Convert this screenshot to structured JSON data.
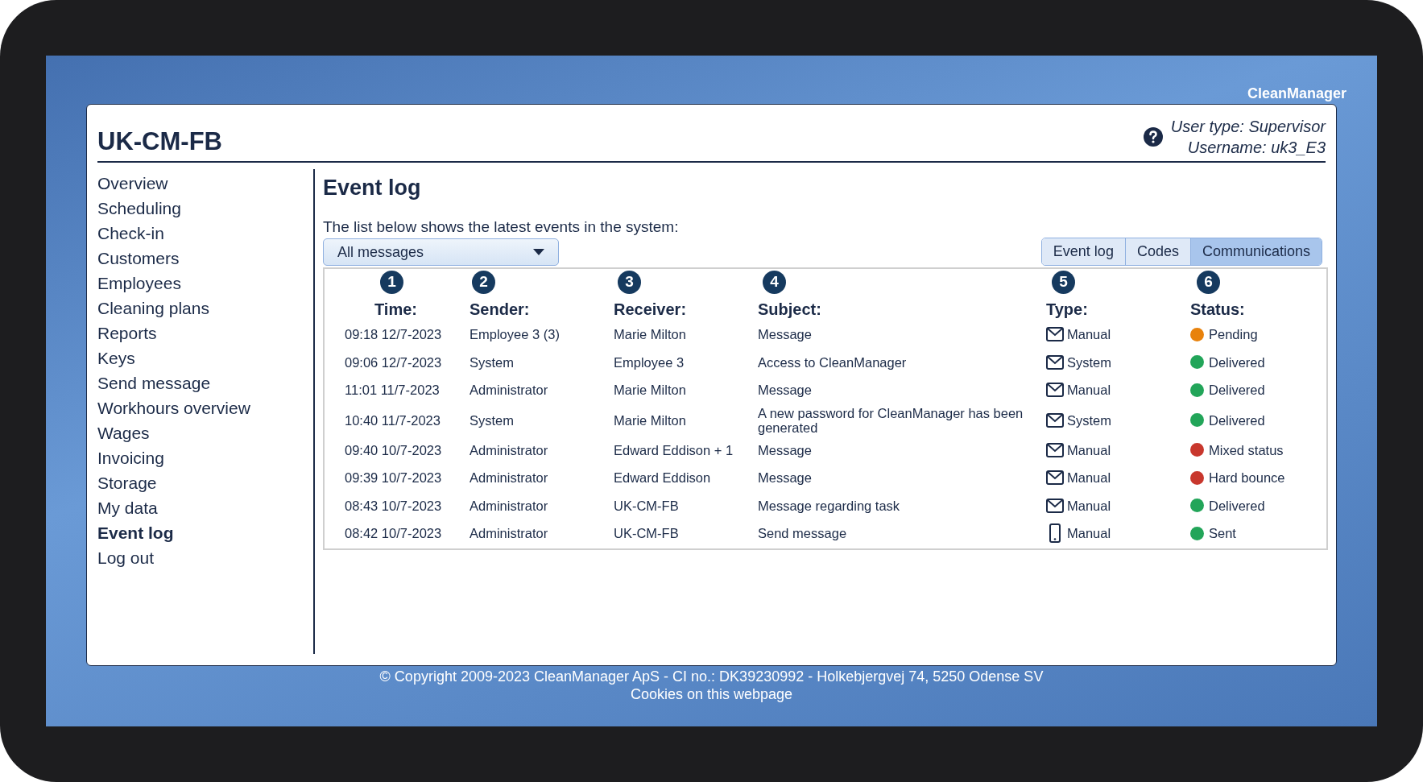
{
  "brand": "CleanManager",
  "header": {
    "title": "UK-CM-FB",
    "user_type": "User type: Supervisor",
    "username": "Username: uk3_E3"
  },
  "sidebar": {
    "items": [
      {
        "label": "Overview",
        "selected": false
      },
      {
        "label": "Scheduling",
        "selected": false
      },
      {
        "label": "Check-in",
        "selected": false
      },
      {
        "label": "Customers",
        "selected": false
      },
      {
        "label": "Employees",
        "selected": false
      },
      {
        "label": "Cleaning plans",
        "selected": false
      },
      {
        "label": "Reports",
        "selected": false
      },
      {
        "label": "Keys",
        "selected": false
      },
      {
        "label": "Send message",
        "selected": false
      },
      {
        "label": "Workhours overview",
        "selected": false
      },
      {
        "label": "Wages",
        "selected": false
      },
      {
        "label": "Invoicing",
        "selected": false
      },
      {
        "label": "Storage",
        "selected": false
      },
      {
        "label": "My data",
        "selected": false
      },
      {
        "label": "Event log",
        "selected": true
      },
      {
        "label": "Log out",
        "selected": false
      }
    ]
  },
  "main": {
    "heading": "Event log",
    "description": "The list below shows the latest events in the system:",
    "filter": {
      "value": "All messages"
    },
    "tabs": [
      {
        "label": "Event log",
        "selected": false
      },
      {
        "label": "Codes",
        "selected": false
      },
      {
        "label": "Communications",
        "selected": true
      }
    ],
    "callouts": [
      "1",
      "2",
      "3",
      "4",
      "5",
      "6"
    ],
    "table": {
      "columns": [
        "Time:",
        "Sender:",
        "Receiver:",
        "Subject:",
        "Type:",
        "Status:"
      ],
      "rows": [
        {
          "time": "09:18 12/7-2023",
          "sender": "Employee 3 (3)",
          "receiver": "Marie Milton",
          "subject": "Message",
          "kind": "email",
          "type": "Manual",
          "status": "Pending",
          "color": "#e8820c"
        },
        {
          "time": "09:06 12/7-2023",
          "sender": "System",
          "receiver": "Employee 3",
          "subject": "Access to CleanManager",
          "kind": "email",
          "type": "System",
          "status": "Delivered",
          "color": "#22a559"
        },
        {
          "time": "11:01 11/7-2023",
          "sender": "Administrator",
          "receiver": "Marie Milton",
          "subject": "Message",
          "kind": "email",
          "type": "Manual",
          "status": "Delivered",
          "color": "#22a559"
        },
        {
          "time": "10:40 11/7-2023",
          "sender": "System",
          "receiver": "Marie Milton",
          "subject": "A new password for CleanManager has been generated",
          "kind": "email",
          "type": "System",
          "status": "Delivered",
          "color": "#22a559"
        },
        {
          "time": "09:40 10/7-2023",
          "sender": "Administrator",
          "receiver": "Edward Eddison + 1",
          "subject": "Message",
          "kind": "email",
          "type": "Manual",
          "status": "Mixed status",
          "color": "#c8372d"
        },
        {
          "time": "09:39 10/7-2023",
          "sender": "Administrator",
          "receiver": "Edward Eddison",
          "subject": "Message",
          "kind": "email",
          "type": "Manual",
          "status": "Hard bounce",
          "color": "#c8372d"
        },
        {
          "time": "08:43 10/7-2023",
          "sender": "Administrator",
          "receiver": "UK-CM-FB",
          "subject": "Message regarding task",
          "kind": "email",
          "type": "Manual",
          "status": "Delivered",
          "color": "#22a559"
        },
        {
          "time": "08:42 10/7-2023",
          "sender": "Administrator",
          "receiver": "UK-CM-FB",
          "subject": "Send message",
          "kind": "sms",
          "type": "Manual",
          "status": "Sent",
          "color": "#22a559"
        }
      ]
    }
  },
  "footer": {
    "copyright": "© Copyright 2009-2023 CleanManager ApS - CI no.: DK39230992 - Holkebjergvej 74, 5250 Odense SV",
    "link": "Cookies on this webpage"
  }
}
